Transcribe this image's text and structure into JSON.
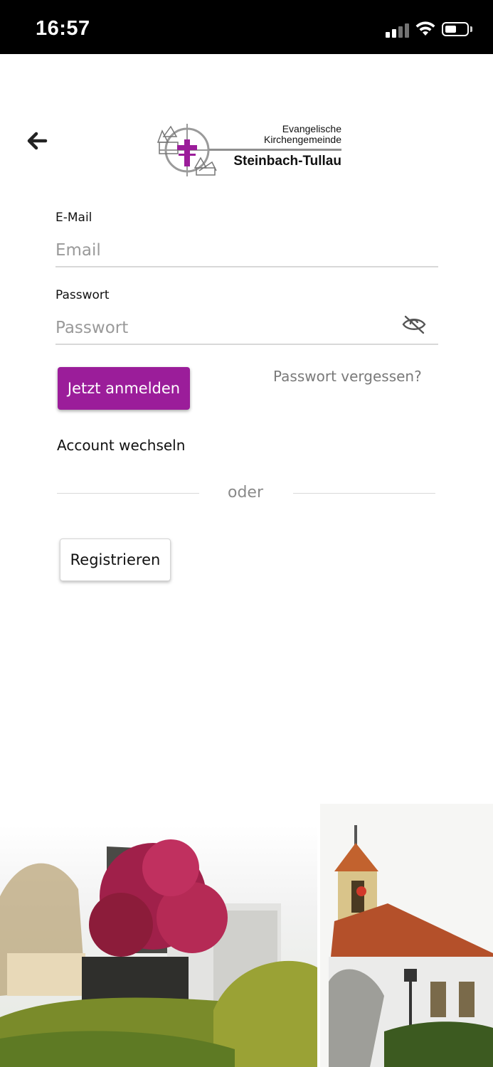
{
  "status_bar": {
    "time": "16:57"
  },
  "logo": {
    "line1": "Evangelische",
    "line2": "Kirchengemeinde",
    "title": "Steinbach-Tullau",
    "accent_color": "#9b1d9a"
  },
  "form": {
    "email_label": "E-Mail",
    "email_placeholder": "Email",
    "password_label": "Passwort",
    "password_placeholder": "Passwort",
    "password_toggle_icon": "eye-slash-icon",
    "login_label": "Jetzt anmelden",
    "forgot_label": "Passwort vergessen?",
    "switch_account_label": "Account wechseln",
    "divider_label": "oder",
    "register_label": "Registrieren"
  },
  "colors": {
    "primary": "#9b1d9a",
    "status_bar": "#000000"
  }
}
